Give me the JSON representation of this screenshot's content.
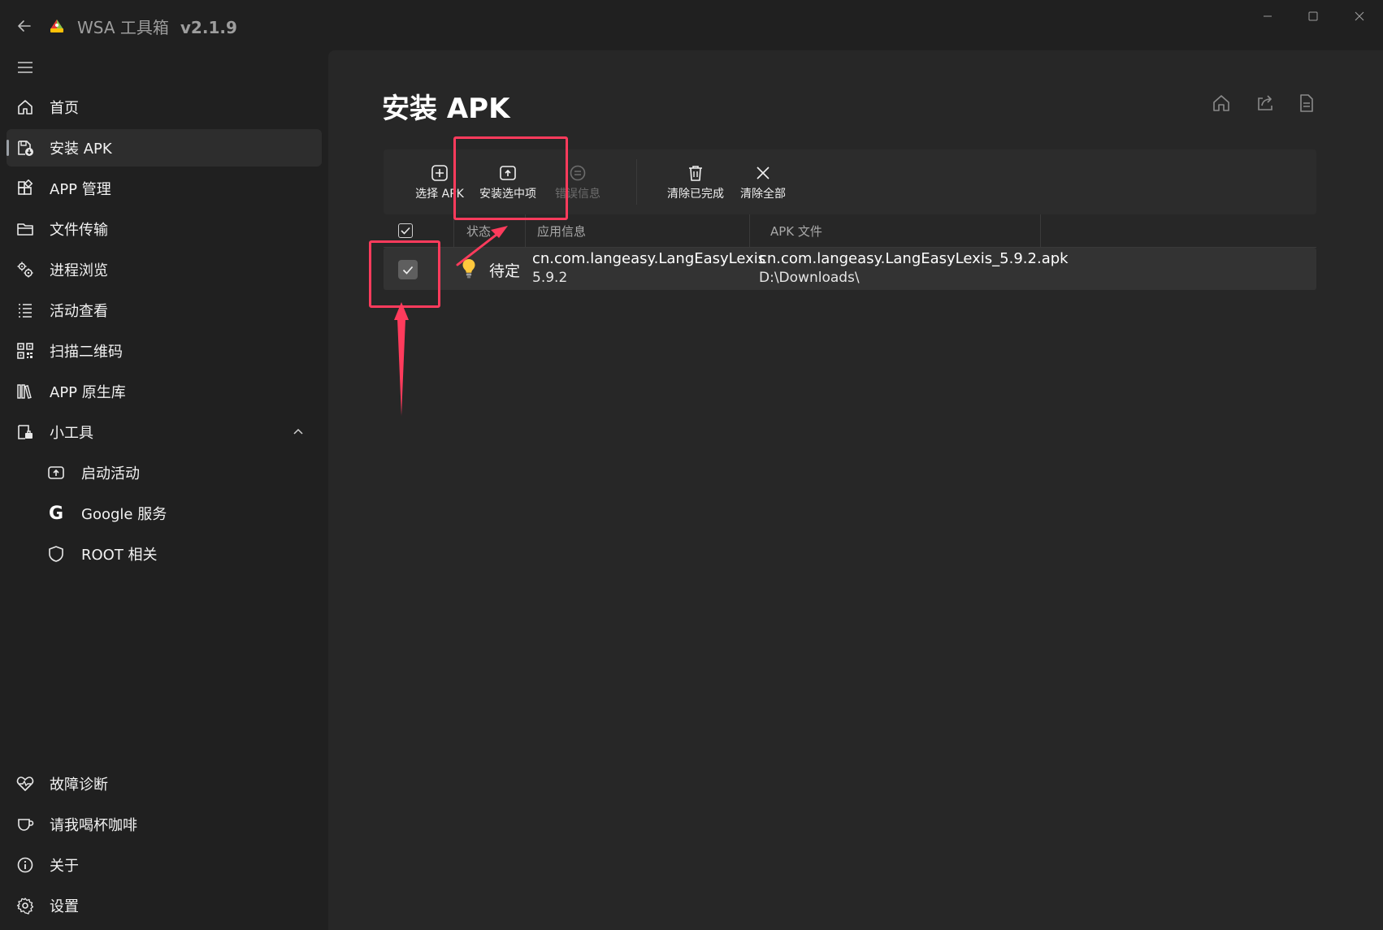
{
  "window": {
    "title": "WSA 工具箱",
    "version": "v2.1.9"
  },
  "sidebar": {
    "items": [
      {
        "label": "首页",
        "icon": "home-icon"
      },
      {
        "label": "安装 APK",
        "icon": "install-apk-icon",
        "selected": true
      },
      {
        "label": "APP 管理",
        "icon": "app-grid-icon"
      },
      {
        "label": "文件传输",
        "icon": "folder-icon"
      },
      {
        "label": "进程浏览",
        "icon": "gears-icon"
      },
      {
        "label": "活动查看",
        "icon": "list-icon"
      },
      {
        "label": "扫描二维码",
        "icon": "qr-code-icon"
      },
      {
        "label": "APP 原生库",
        "icon": "library-icon"
      },
      {
        "label": "小工具",
        "icon": "toolbox-icon",
        "expanded": true
      },
      {
        "label": "启动活动",
        "icon": "launch-icon"
      },
      {
        "label": "Google 服务",
        "icon": "google-icon"
      },
      {
        "label": "ROOT 相关",
        "icon": "shield-icon"
      }
    ],
    "footer_items": [
      {
        "label": "故障诊断",
        "icon": "heart-pulse-icon"
      },
      {
        "label": "请我喝杯咖啡",
        "icon": "coffee-cup-icon"
      },
      {
        "label": "关于",
        "icon": "info-icon"
      },
      {
        "label": "设置",
        "icon": "settings-icon"
      }
    ]
  },
  "page": {
    "title": "安装 APK"
  },
  "toolbar": {
    "buttons": [
      {
        "label": "选择 APK",
        "icon": "add-square-icon",
        "enabled": true
      },
      {
        "label": "安装选中项",
        "icon": "upload-icon",
        "enabled": true
      },
      {
        "label": "错误信息",
        "icon": "error-info-icon",
        "enabled": false
      },
      {
        "label": "清除已完成",
        "icon": "trash-icon",
        "enabled": true
      },
      {
        "label": "清除全部",
        "icon": "close-icon",
        "enabled": true
      }
    ]
  },
  "table": {
    "columns": [
      "状态",
      "应用信息",
      "APK 文件"
    ],
    "select_all_checked": true,
    "rows": [
      {
        "checked": true,
        "status": "待定",
        "package": "cn.com.langeasy.LangEasyLexis",
        "version": "5.9.2",
        "apk_file": "cn.com.langeasy.LangEasyLexis_5.9.2.apk",
        "apk_dir": "D:\\Downloads\\"
      }
    ]
  },
  "colors": {
    "background": "#202020",
    "content_background": "#272727",
    "annotation": "#ff3b5c"
  }
}
